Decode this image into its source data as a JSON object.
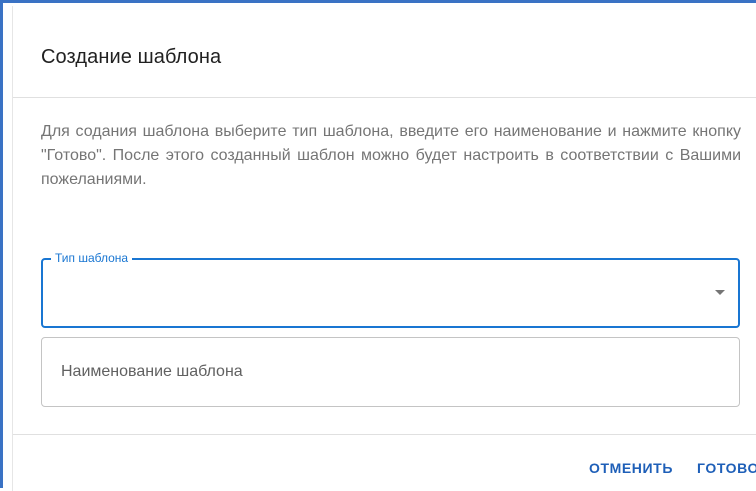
{
  "dialog": {
    "title": "Создание шаблона",
    "description": "Для содания шаблона выберите тип шаблона, введите его наименование и нажмите кнопку \"Готово\". После этого созданный шаблон можно будет настроить в соответствии с Вашими пожеланиями.",
    "template_type": {
      "label": "Тип шаблона",
      "value": ""
    },
    "template_name": {
      "placeholder": "Наименование шаблона",
      "value": ""
    },
    "actions": {
      "cancel_label": "ОТМЕНИТЬ",
      "done_label": "ГОТОВО"
    }
  },
  "colors": {
    "accent": "#1976d2",
    "frame": "#3a72c4",
    "button_text": "#1e5fb8"
  },
  "icons": {
    "select_arrow": "chevron-down-icon"
  }
}
